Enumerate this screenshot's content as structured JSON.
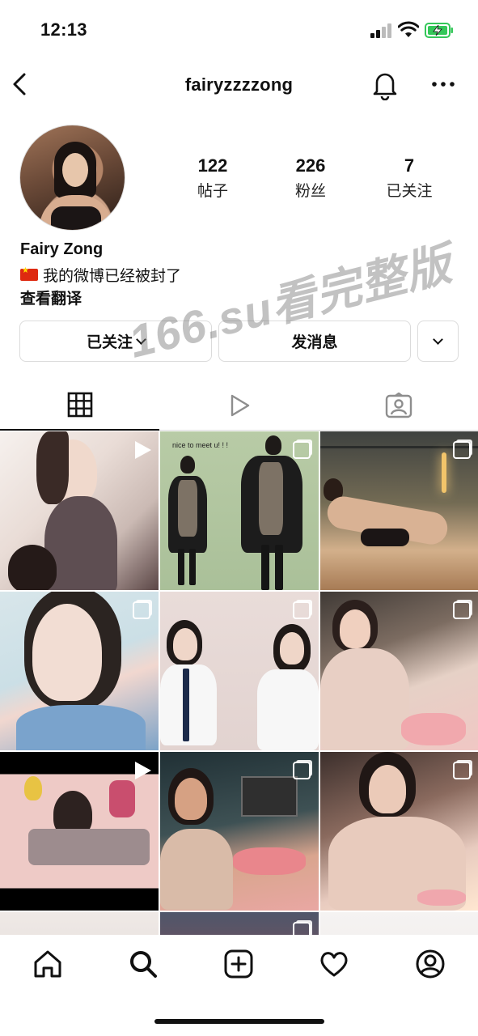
{
  "status_bar": {
    "time": "12:13"
  },
  "header": {
    "username": "fairyzzzzong"
  },
  "profile": {
    "stats": [
      {
        "value": "122",
        "label": "帖子"
      },
      {
        "value": "226",
        "label": "粉丝"
      },
      {
        "value": "7",
        "label": "已关注"
      }
    ],
    "name": "Fairy Zong",
    "bio": "我的微博已经被封了",
    "see_translation": "查看翻译"
  },
  "actions": {
    "following_label": "已关注",
    "message_label": "发消息"
  },
  "watermark": "166.su看完整版",
  "tabs": [
    {
      "icon": "grid-icon",
      "active": true
    },
    {
      "icon": "reels-icon",
      "active": false
    },
    {
      "icon": "tagged-icon",
      "active": false
    }
  ],
  "posts": [
    {
      "badge": "video"
    },
    {
      "badge": "carousel",
      "caption": "nice to meet u! ! !"
    },
    {
      "badge": "carousel"
    },
    {
      "badge": "carousel"
    },
    {
      "badge": "carousel"
    },
    {
      "badge": "carousel"
    },
    {
      "badge": "video"
    },
    {
      "badge": "carousel"
    },
    {
      "badge": "carousel"
    },
    {
      "badge": "none"
    },
    {
      "badge": "carousel"
    },
    {
      "badge": "none"
    }
  ],
  "bottom_nav": [
    "home-icon",
    "search-icon",
    "create-icon",
    "activity-icon",
    "profile-icon"
  ],
  "colors": {
    "text": "#111111",
    "border": "#dbdbdb",
    "battery_green": "#34c759"
  }
}
